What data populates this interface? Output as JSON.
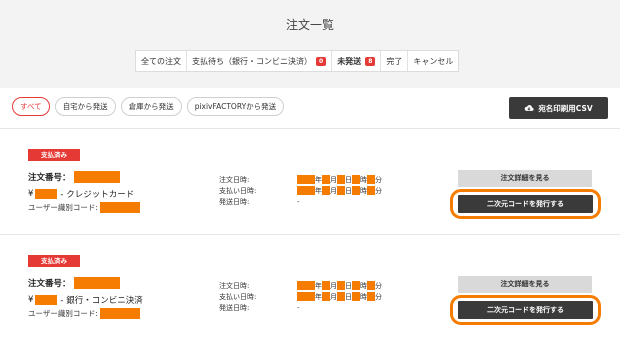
{
  "page": {
    "title": "注文一覧"
  },
  "status_tabs": [
    {
      "label": "全ての注文",
      "count": null,
      "bold": false
    },
    {
      "label": "支払待ち（銀行・コンビニ決済）",
      "count": "0",
      "bold": false
    },
    {
      "label": "未発送",
      "count": "8",
      "bold": true
    },
    {
      "label": "完了",
      "count": null,
      "bold": false
    },
    {
      "label": "キャンセル",
      "count": null,
      "bold": false
    }
  ],
  "filters": [
    {
      "label": "すべて",
      "active": true
    },
    {
      "label": "自宅から発送",
      "active": false
    },
    {
      "label": "倉庫から発送",
      "active": false
    },
    {
      "label": "pixivFACTORYから発送",
      "active": false
    }
  ],
  "csv_button": {
    "label": "宛名印刷用CSV",
    "icon": "cloud-download-icon"
  },
  "orders": [
    {
      "status_badge": "支払済み",
      "order_number_label": "注文番号：",
      "price_prefix": "¥",
      "payment_method": "- クレジットカード",
      "user_id_label": "ユーザー識別コード:",
      "date_labels": {
        "ordered": "注文日時:",
        "paid": "支払い日時:",
        "shipped": "発送日時:"
      },
      "date_units": {
        "year": "年",
        "month": "月",
        "day": "日",
        "hour": "時",
        "minute": "分"
      },
      "shipped_value": "-",
      "detail_button": "注文詳細を見る",
      "issue_button": "二次元コードを発行する"
    },
    {
      "status_badge": "支払済み",
      "order_number_label": "注文番号：",
      "price_prefix": "¥",
      "payment_method": "- 銀行・コンビニ決済",
      "user_id_label": "ユーザー識別コード:",
      "date_labels": {
        "ordered": "注文日時:",
        "paid": "支払い日時:",
        "shipped": "発送日時:"
      },
      "date_units": {
        "year": "年",
        "month": "月",
        "day": "日",
        "hour": "時",
        "minute": "分"
      },
      "shipped_value": "-",
      "detail_button": "注文詳細を見る",
      "issue_button": "二次元コードを発行する"
    }
  ],
  "colors": {
    "accent": "#e53935",
    "highlight": "#f57c00",
    "dark_button": "#3a3a3a"
  }
}
